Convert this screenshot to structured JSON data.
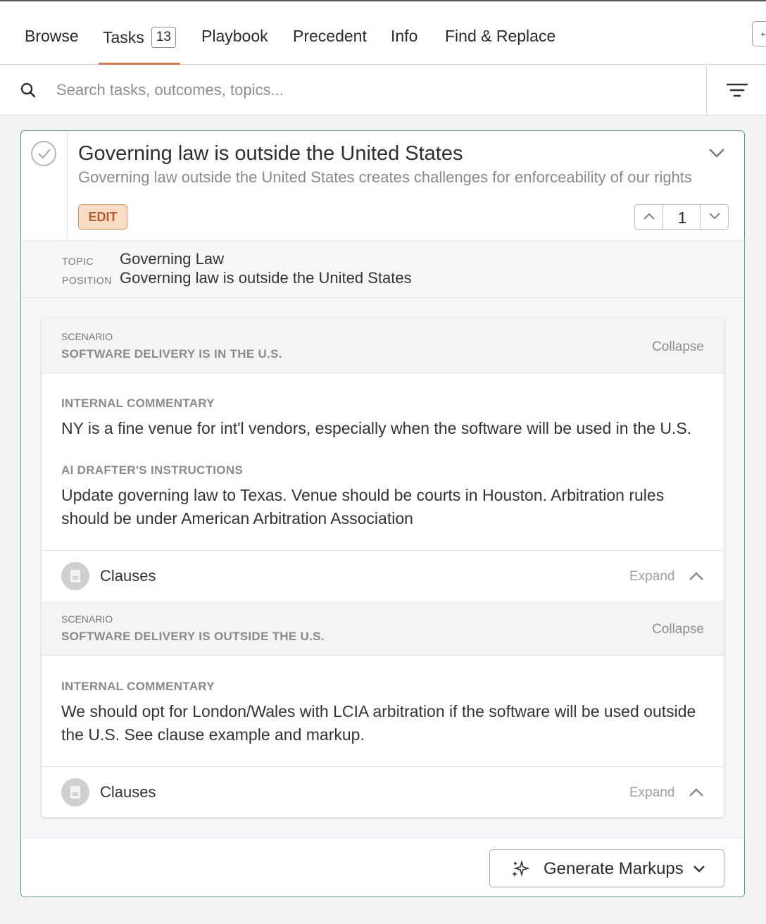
{
  "tabs": [
    {
      "label": "Browse"
    },
    {
      "label": "Tasks",
      "badge": "13",
      "active": true
    },
    {
      "label": "Playbook"
    },
    {
      "label": "Precedent"
    },
    {
      "label": "Info"
    },
    {
      "label": "Find & Replace"
    }
  ],
  "search": {
    "placeholder": "Search tasks, outcomes, topics...",
    "value": ""
  },
  "task": {
    "title": "Governing law is outside the United States",
    "subtitle": "Governing law outside the United States creates challenges for enforceability of our rights",
    "edit_label": "EDIT",
    "page_number": "1",
    "topic_label": "TOPIC",
    "topic_value": "Governing Law",
    "position_label": "POSITION",
    "position_value": "Governing law is outside the United States"
  },
  "scenarios": [
    {
      "label": "SCENARIO",
      "name": "SOFTWARE DELIVERY IS IN THE U.S.",
      "collapse_label": "Collapse",
      "commentary_label": "INTERNAL COMMENTARY",
      "commentary": "NY is a fine venue for int'l vendors, especially when the software will be used in the U.S.",
      "instructions_label": "AI DRAFTER'S INSTRUCTIONS",
      "instructions": "Update governing law to Texas. Venue should be courts in Houston. Arbitration rules should be under American Arbitration Association",
      "clauses_label": "Clauses",
      "expand_label": "Expand"
    },
    {
      "label": "SCENARIO",
      "name": "SOFTWARE DELIVERY IS OUTSIDE THE U.S.",
      "collapse_label": "Collapse",
      "commentary_label": "INTERNAL COMMENTARY",
      "commentary": "We should opt for London/Wales with LCIA arbitration if the software will be used outside the U.S. See clause example and markup.",
      "clauses_label": "Clauses",
      "expand_label": "Expand"
    }
  ],
  "footer": {
    "generate_label": "Generate Markups"
  },
  "colors": {
    "accent_tab": "#e07a4e",
    "card_border": "#5e9c94",
    "edit_bg": "#f9dcc6",
    "edit_text": "#b65d2c"
  }
}
